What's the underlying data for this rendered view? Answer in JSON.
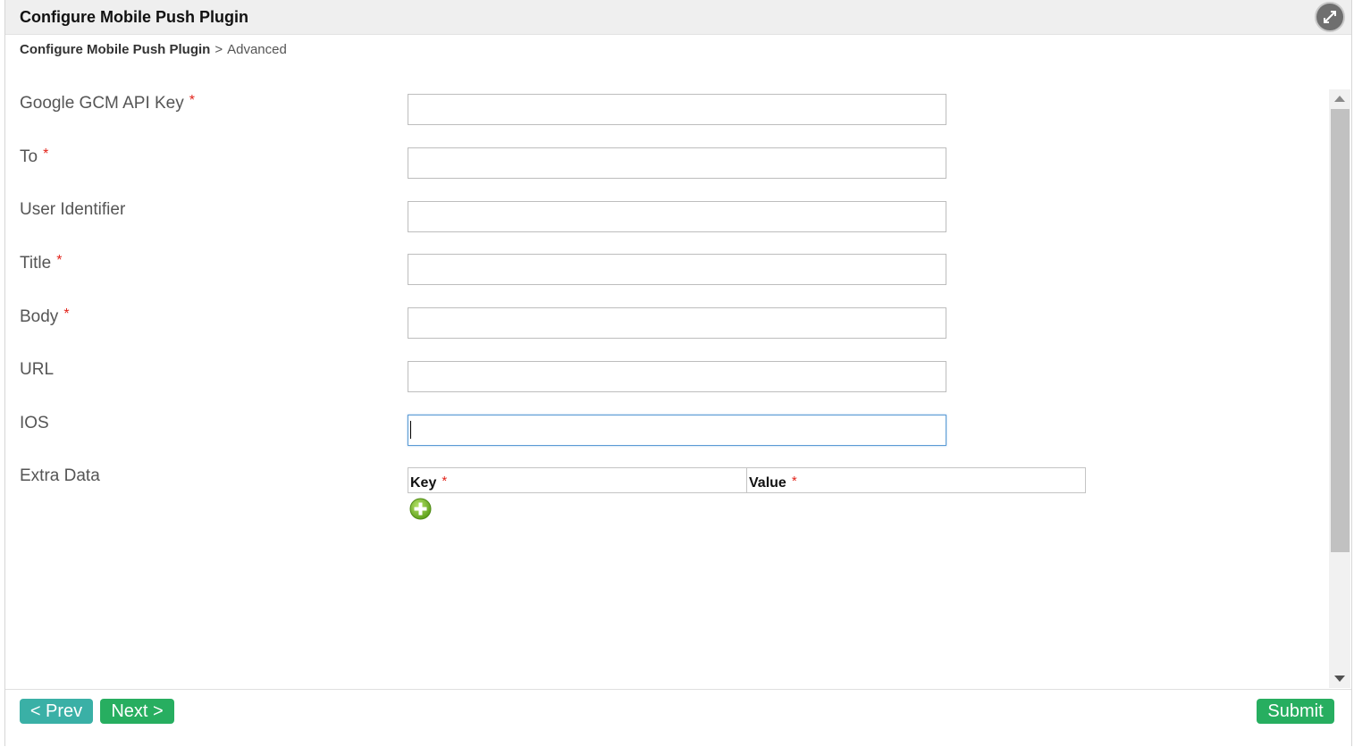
{
  "dialog": {
    "title": "Configure Mobile Push Plugin",
    "expand_icon": "expand-icon"
  },
  "breadcrumb": {
    "current": "Configure Mobile Push Plugin",
    "separator": ">",
    "next": "Advanced"
  },
  "form": {
    "required_marker": "*",
    "fields": [
      {
        "label": "Google GCM API Key",
        "required": true,
        "value": ""
      },
      {
        "label": "To",
        "required": true,
        "value": ""
      },
      {
        "label": "User Identifier",
        "required": false,
        "value": ""
      },
      {
        "label": "Title",
        "required": true,
        "value": ""
      },
      {
        "label": "Body",
        "required": true,
        "value": ""
      },
      {
        "label": "URL",
        "required": false,
        "value": ""
      },
      {
        "label": "IOS",
        "required": false,
        "value": "",
        "focused": true
      }
    ],
    "extra_data": {
      "label": "Extra Data",
      "columns": [
        {
          "header": "Key",
          "required": true
        },
        {
          "header": "Value",
          "required": true
        }
      ],
      "add_icon": "add-circle-icon"
    }
  },
  "footer": {
    "prev_label": "< Prev",
    "next_label": "Next >",
    "submit_label": "Submit"
  },
  "colors": {
    "prev_button": "#3ab0a6",
    "next_button": "#27ae60",
    "submit_button": "#27ae60",
    "required_marker": "#e2231a",
    "add_icon": "#7ac231"
  }
}
